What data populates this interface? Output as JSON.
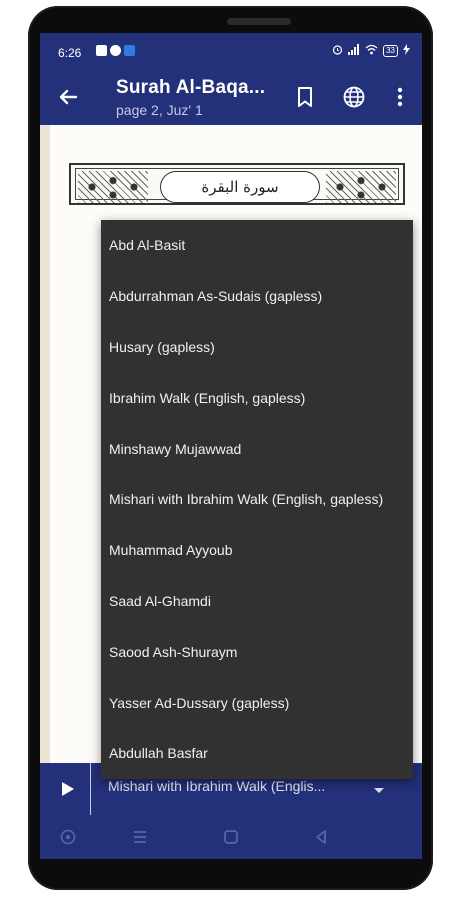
{
  "status_bar": {
    "time": "6:26",
    "battery": "33",
    "left_icons": [
      "notification-icon",
      "messenger-icon",
      "app-icon"
    ],
    "right_icons": [
      "alarm-icon",
      "signal-icon",
      "wifi-icon",
      "battery-icon"
    ]
  },
  "toolbar": {
    "title": "Surah Al-Baqa...",
    "subtitle": "page 2, Juz' 1",
    "icons": [
      "back-arrow-icon",
      "bookmark-icon",
      "globe-icon",
      "more-vert-icon"
    ]
  },
  "page": {
    "header_text": "سورة البقرة"
  },
  "dropdown": {
    "options": [
      "Abd Al-Basit",
      "Abdurrahman As-Sudais (gapless)",
      "Husary (gapless)",
      "Ibrahim Walk (English, gapless)",
      "Minshawy Mujawwad",
      "Mishari with Ibrahim Walk (English, gapless)",
      "Muhammad Ayyoub",
      "Saad Al-Ghamdi",
      "Saood Ash-Shuraym",
      "Yasser Ad-Dussary (gapless)",
      "Abdullah Basfar"
    ]
  },
  "audio_bar": {
    "selected": "Mishari with Ibrahim Walk (Englis...",
    "icons": [
      "play-icon",
      "dropdown-caret-icon"
    ]
  },
  "nav_bar": {
    "icons": [
      "accessibility-icon",
      "recents-icon",
      "home-icon",
      "back-icon"
    ]
  },
  "colors": {
    "primary": "#23307a",
    "menu_bg": "#313131",
    "page_bg": "#fdfcf8"
  }
}
